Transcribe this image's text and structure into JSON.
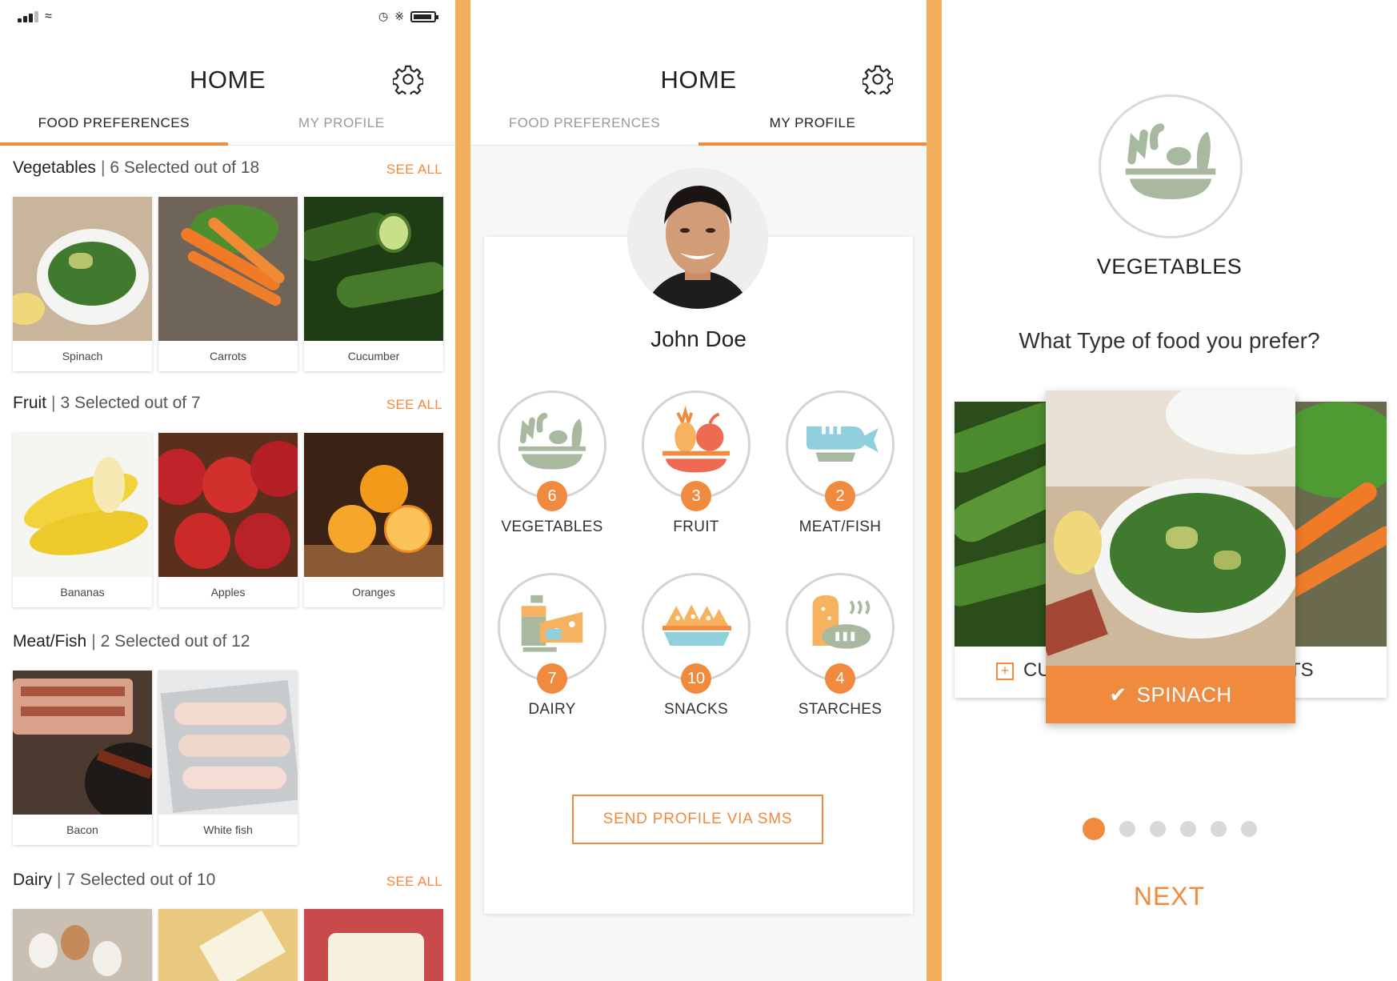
{
  "home": {
    "title": "HOME",
    "tabs": {
      "food_preferences": "FOOD PREFERENCES",
      "my_profile": "MY PROFILE"
    }
  },
  "preferences": {
    "see_all": "SEE ALL",
    "sections": [
      {
        "name": "Vegetables",
        "count": "6 Selected out of 18",
        "items": [
          "Spinach",
          "Carrots",
          "Cucumber"
        ]
      },
      {
        "name": "Fruit",
        "count": "3 Selected out of 7",
        "items": [
          "Bananas",
          "Apples",
          "Oranges"
        ]
      },
      {
        "name": "Meat/Fish",
        "count": "2 Selected out of 12",
        "items": [
          "Bacon",
          "White fish"
        ]
      },
      {
        "name": "Dairy",
        "count": "7 Selected out of 10",
        "items": []
      }
    ]
  },
  "profile": {
    "name": "John Doe",
    "categories": [
      {
        "label": "VEGETABLES",
        "count": "6",
        "icon": "vegetable-bowl-icon"
      },
      {
        "label": "FRUIT",
        "count": "3",
        "icon": "fruit-bowl-icon"
      },
      {
        "label": "MEAT/FISH",
        "count": "2",
        "icon": "fish-icon"
      },
      {
        "label": "DAIRY",
        "count": "7",
        "icon": "dairy-icon"
      },
      {
        "label": "SNACKS",
        "count": "10",
        "icon": "snacks-icon"
      },
      {
        "label": "STARCHES",
        "count": "4",
        "icon": "bread-icon"
      }
    ],
    "sms_button": "SEND PROFILE VIA SMS"
  },
  "picker": {
    "category": "VEGETABLES",
    "question": "What Type of food you prefer?",
    "left_card_label": "CU",
    "right_card_label": "ROTS",
    "selected": "SPINACH",
    "next": "NEXT",
    "page_index": 1,
    "page_count": 6
  },
  "colors": {
    "accent": "#f08a3e",
    "divider": "#f2ae5a",
    "icon_green": "#a9b9a0",
    "icon_blue": "#8fd0dc"
  }
}
